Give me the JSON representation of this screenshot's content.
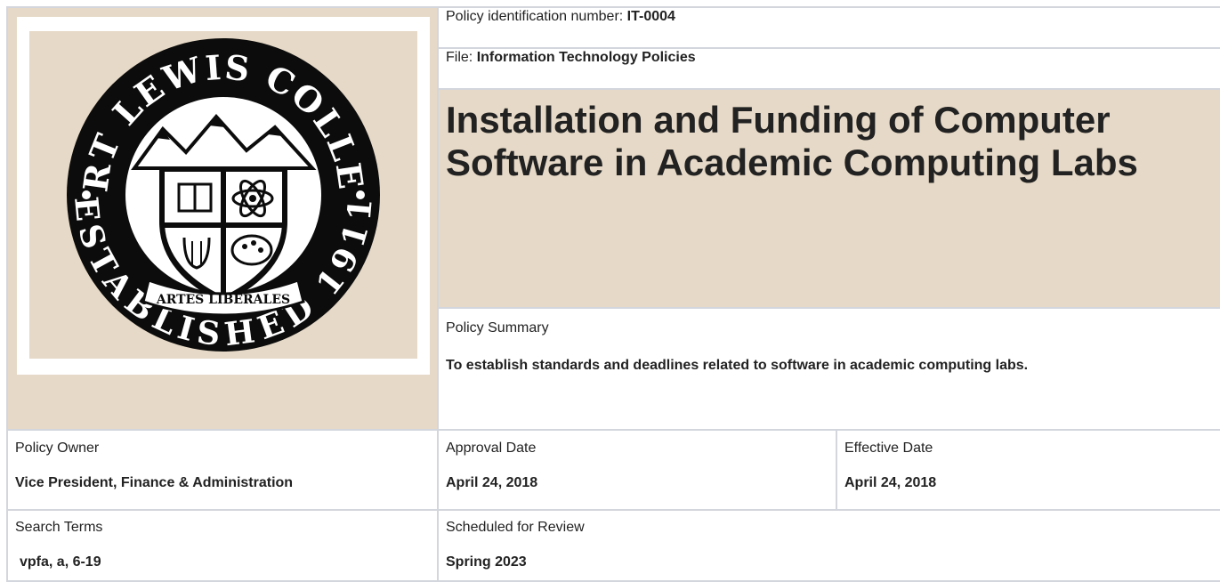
{
  "seal": {
    "college_name": "FORT LEWIS COLLEGE",
    "ribbon": "ARTES LIBERALES",
    "established": "ESTABLISHED 1911"
  },
  "header": {
    "policy_id_label": "Policy identification number:",
    "policy_id_value": "IT-0004",
    "file_label": "File:",
    "file_value": "Information Technology Policies",
    "title": "Installation and Funding of Computer Software in Academic Computing Labs"
  },
  "summary": {
    "label": "Policy Summary",
    "text": "To establish standards and deadlines related to software in academic computing labs."
  },
  "meta": {
    "owner_label": "Policy Owner",
    "owner_value": "Vice President, Finance & Administration",
    "approval_label": "Approval Date",
    "approval_value": "April 24, 2018",
    "effective_label": "Effective Date",
    "effective_value": "April 24, 2018",
    "search_label": "Search Terms",
    "search_value": "vpfa, a, 6-19",
    "review_label": "Scheduled for Review",
    "review_value": "Spring 2023"
  }
}
